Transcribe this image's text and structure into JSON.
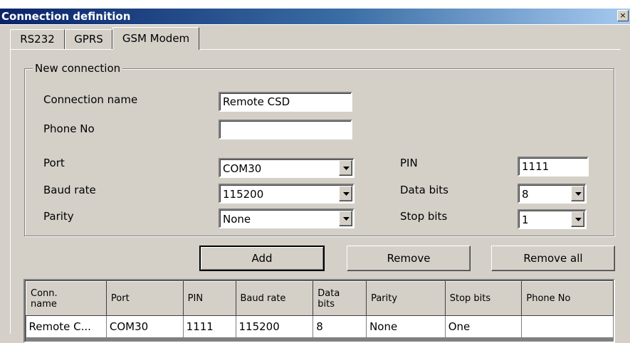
{
  "window": {
    "title": "Connection definition",
    "close_glyph": "×"
  },
  "tabs": [
    {
      "label": "RS232"
    },
    {
      "label": "GPRS"
    },
    {
      "label": "GSM Modem",
      "active": true
    }
  ],
  "group": {
    "legend": "New connection"
  },
  "form": {
    "connection_name_label": "Connection name",
    "connection_name_value": "Remote CSD",
    "phone_label": "Phone No",
    "phone_value": "",
    "port_label": "Port",
    "port_value": "COM30",
    "baud_label": "Baud rate",
    "baud_value": "115200",
    "parity_label": "Parity",
    "parity_value": "None",
    "pin_label": "PIN",
    "pin_value": "1111",
    "data_bits_label": "Data bits",
    "data_bits_value": "8",
    "stop_bits_label": "Stop bits",
    "stop_bits_value": "1"
  },
  "buttons": {
    "add": "Add",
    "remove": "Remove",
    "remove_all": "Remove all"
  },
  "table": {
    "columns": [
      {
        "line1": "Conn.",
        "line2": "name"
      },
      {
        "line1": "Port",
        "line2": ""
      },
      {
        "line1": "PIN",
        "line2": ""
      },
      {
        "line1": "Baud rate",
        "line2": ""
      },
      {
        "line1": "Data",
        "line2": "bits"
      },
      {
        "line1": "Parity",
        "line2": ""
      },
      {
        "line1": "Stop bits",
        "line2": ""
      },
      {
        "line1": "Phone No",
        "line2": ""
      }
    ],
    "rows": [
      [
        "Remote C...",
        "COM30",
        "1111",
        "115200",
        "8",
        "None",
        "One",
        ""
      ]
    ]
  },
  "colors": {
    "titlebar_start": "#0a246a",
    "titlebar_end": "#a6caf0",
    "face": "#d4d0c8"
  },
  "icons": {
    "dropdown": "chevron-down-icon",
    "close": "close-icon"
  }
}
